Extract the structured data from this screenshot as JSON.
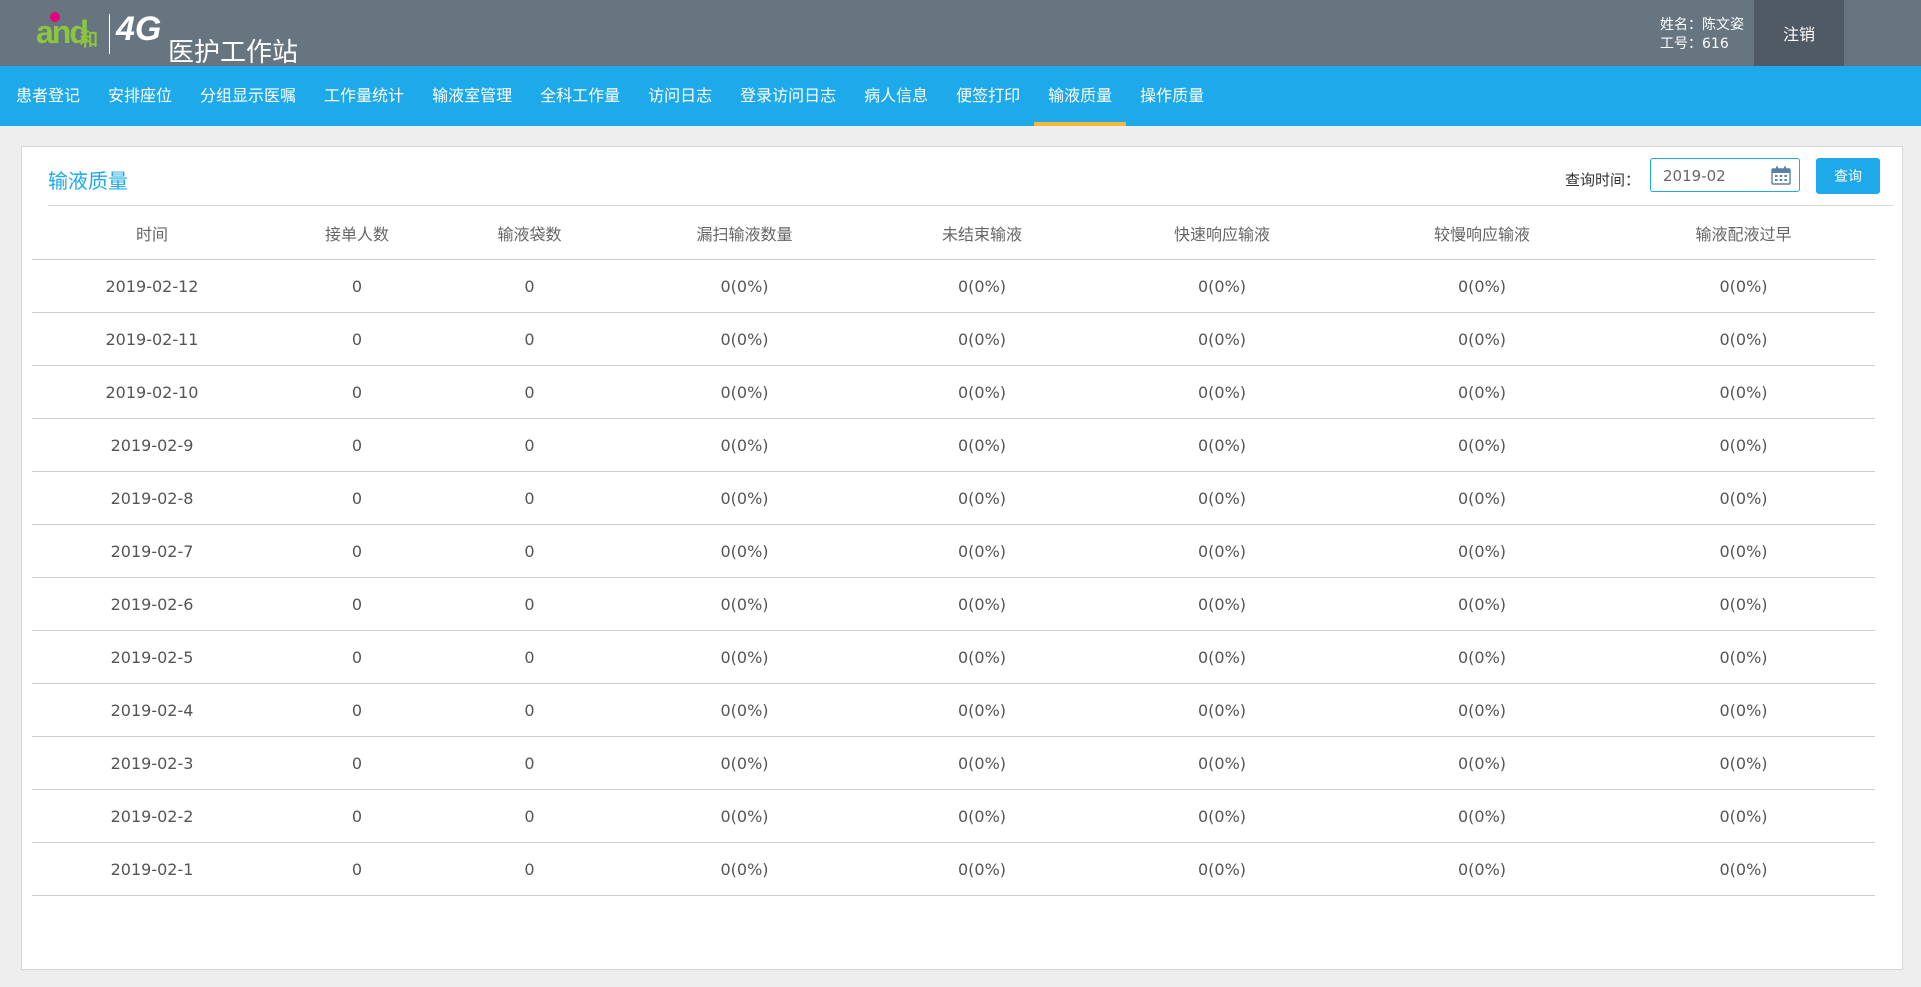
{
  "app": {
    "logo_brand": "and",
    "logo_he": "和",
    "logo_4g": "4G",
    "title": "医护工作站"
  },
  "user": {
    "name_line": "姓名：陈文姿",
    "id_line": "工号：616",
    "logout_label": "注销"
  },
  "nav": {
    "items": [
      "患者登记",
      "安排座位",
      "分组显示医嘱",
      "工作量统计",
      "输液室管理",
      "全科工作量",
      "访问日志",
      "登录访问日志",
      "病人信息",
      "便签打印",
      "输液质量",
      "操作质量"
    ],
    "active_index": 10
  },
  "panel": {
    "title": "输液质量",
    "query_label": "查询时间：",
    "date_value": "2019-02",
    "query_button": "查询"
  },
  "table": {
    "columns": [
      "时间",
      "接单人数",
      "输液袋数",
      "漏扫输液数量",
      "未结束输液",
      "快速响应输液",
      "较慢响应输液",
      "输液配液过早"
    ],
    "rows": [
      [
        "2019-02-12",
        "0",
        "0",
        "0(0%)",
        "0(0%)",
        "0(0%)",
        "0(0%)",
        "0(0%)"
      ],
      [
        "2019-02-11",
        "0",
        "0",
        "0(0%)",
        "0(0%)",
        "0(0%)",
        "0(0%)",
        "0(0%)"
      ],
      [
        "2019-02-10",
        "0",
        "0",
        "0(0%)",
        "0(0%)",
        "0(0%)",
        "0(0%)",
        "0(0%)"
      ],
      [
        "2019-02-9",
        "0",
        "0",
        "0(0%)",
        "0(0%)",
        "0(0%)",
        "0(0%)",
        "0(0%)"
      ],
      [
        "2019-02-8",
        "0",
        "0",
        "0(0%)",
        "0(0%)",
        "0(0%)",
        "0(0%)",
        "0(0%)"
      ],
      [
        "2019-02-7",
        "0",
        "0",
        "0(0%)",
        "0(0%)",
        "0(0%)",
        "0(0%)",
        "0(0%)"
      ],
      [
        "2019-02-6",
        "0",
        "0",
        "0(0%)",
        "0(0%)",
        "0(0%)",
        "0(0%)",
        "0(0%)"
      ],
      [
        "2019-02-5",
        "0",
        "0",
        "0(0%)",
        "0(0%)",
        "0(0%)",
        "0(0%)",
        "0(0%)"
      ],
      [
        "2019-02-4",
        "0",
        "0",
        "0(0%)",
        "0(0%)",
        "0(0%)",
        "0(0%)",
        "0(0%)"
      ],
      [
        "2019-02-3",
        "0",
        "0",
        "0(0%)",
        "0(0%)",
        "0(0%)",
        "0(0%)",
        "0(0%)"
      ],
      [
        "2019-02-2",
        "0",
        "0",
        "0(0%)",
        "0(0%)",
        "0(0%)",
        "0(0%)",
        "0(0%)"
      ],
      [
        "2019-02-1",
        "0",
        "0",
        "0(0%)",
        "0(0%)",
        "0(0%)",
        "0(0%)",
        "0(0%)"
      ]
    ]
  },
  "colors": {
    "header_bg": "#677581",
    "nav_bg": "#1da9ea",
    "nav_active_underline": "#f4b63b",
    "accent": "#1da9ea"
  },
  "icons": {
    "date": "calendar-icon"
  }
}
